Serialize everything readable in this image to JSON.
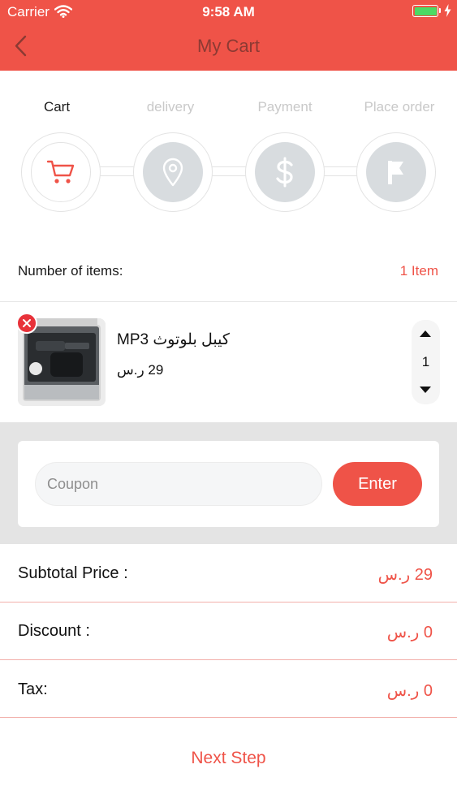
{
  "status_bar": {
    "carrier": "Carrier",
    "time": "9:58 AM",
    "battery_level": 1.0
  },
  "header": {
    "title": "My Cart"
  },
  "steps": [
    {
      "label": "Cart",
      "icon": "cart-icon",
      "active": true
    },
    {
      "label": "delivery",
      "icon": "location-pin-icon",
      "active": false
    },
    {
      "label": "Payment",
      "icon": "dollar-icon",
      "active": false
    },
    {
      "label": "Place order",
      "icon": "flag-icon",
      "active": false
    }
  ],
  "items_summary": {
    "label": "Number of items:",
    "count": "1 Item"
  },
  "cart_items": [
    {
      "name": "كيبل بلوتوث  MP3",
      "price": "29 ر.س",
      "quantity": "1"
    }
  ],
  "coupon": {
    "placeholder": "Coupon",
    "value": "",
    "button_label": "Enter"
  },
  "summary": [
    {
      "label": "Subtotal Price :",
      "value": "29 ر.س"
    },
    {
      "label": "Discount :",
      "value": "0 ر.س"
    },
    {
      "label": "Tax:",
      "value": "0 ر.س"
    }
  ],
  "footer": {
    "next_label": "Next Step"
  },
  "colors": {
    "accent": "#ef5348",
    "inactive_step": "#d8dcdf",
    "remove_badge": "#e8323a"
  }
}
